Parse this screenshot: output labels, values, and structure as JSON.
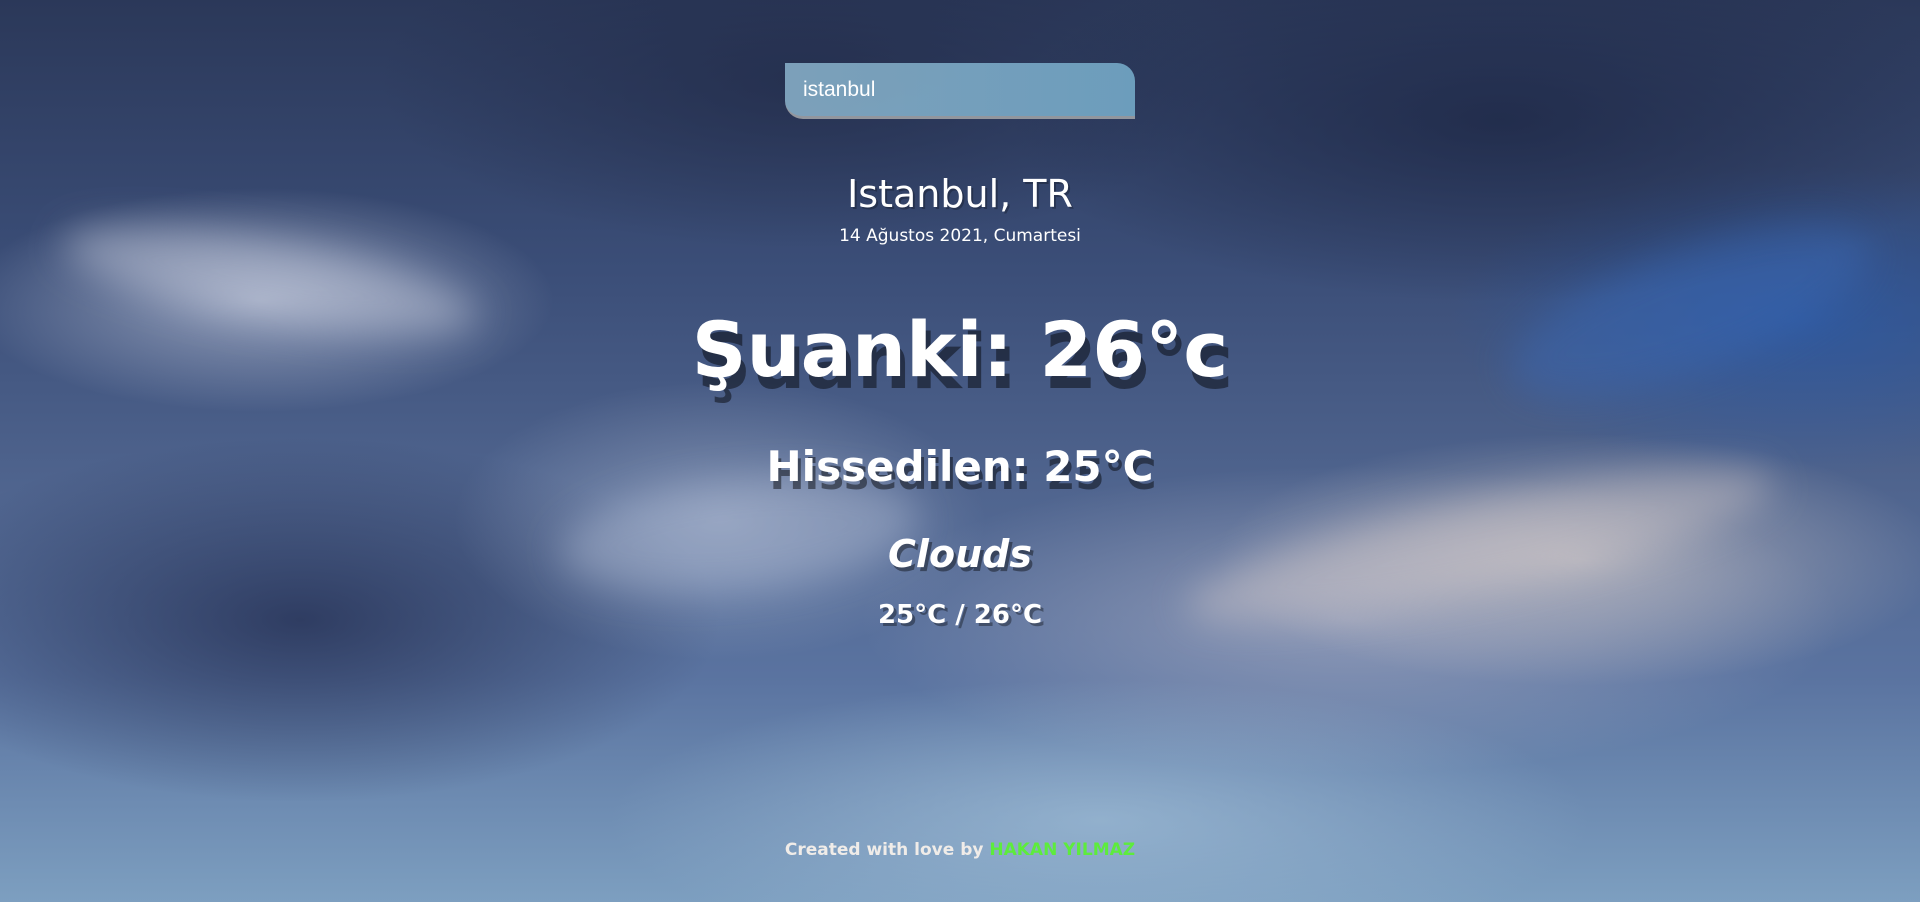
{
  "search": {
    "value": "istanbul"
  },
  "location": {
    "city": "Istanbul, TR",
    "date": "14 Ağustos 2021, Cumartesi"
  },
  "weather": {
    "current": "Şuanki: 26°c",
    "feels_like": "Hissedilen: 25°C",
    "condition": "Clouds",
    "min_max": "25°C / 26°C"
  },
  "footer": {
    "text": "Created with love by",
    "author": "HAKAN YILMAZ",
    "author_color": "#5dec3c"
  }
}
